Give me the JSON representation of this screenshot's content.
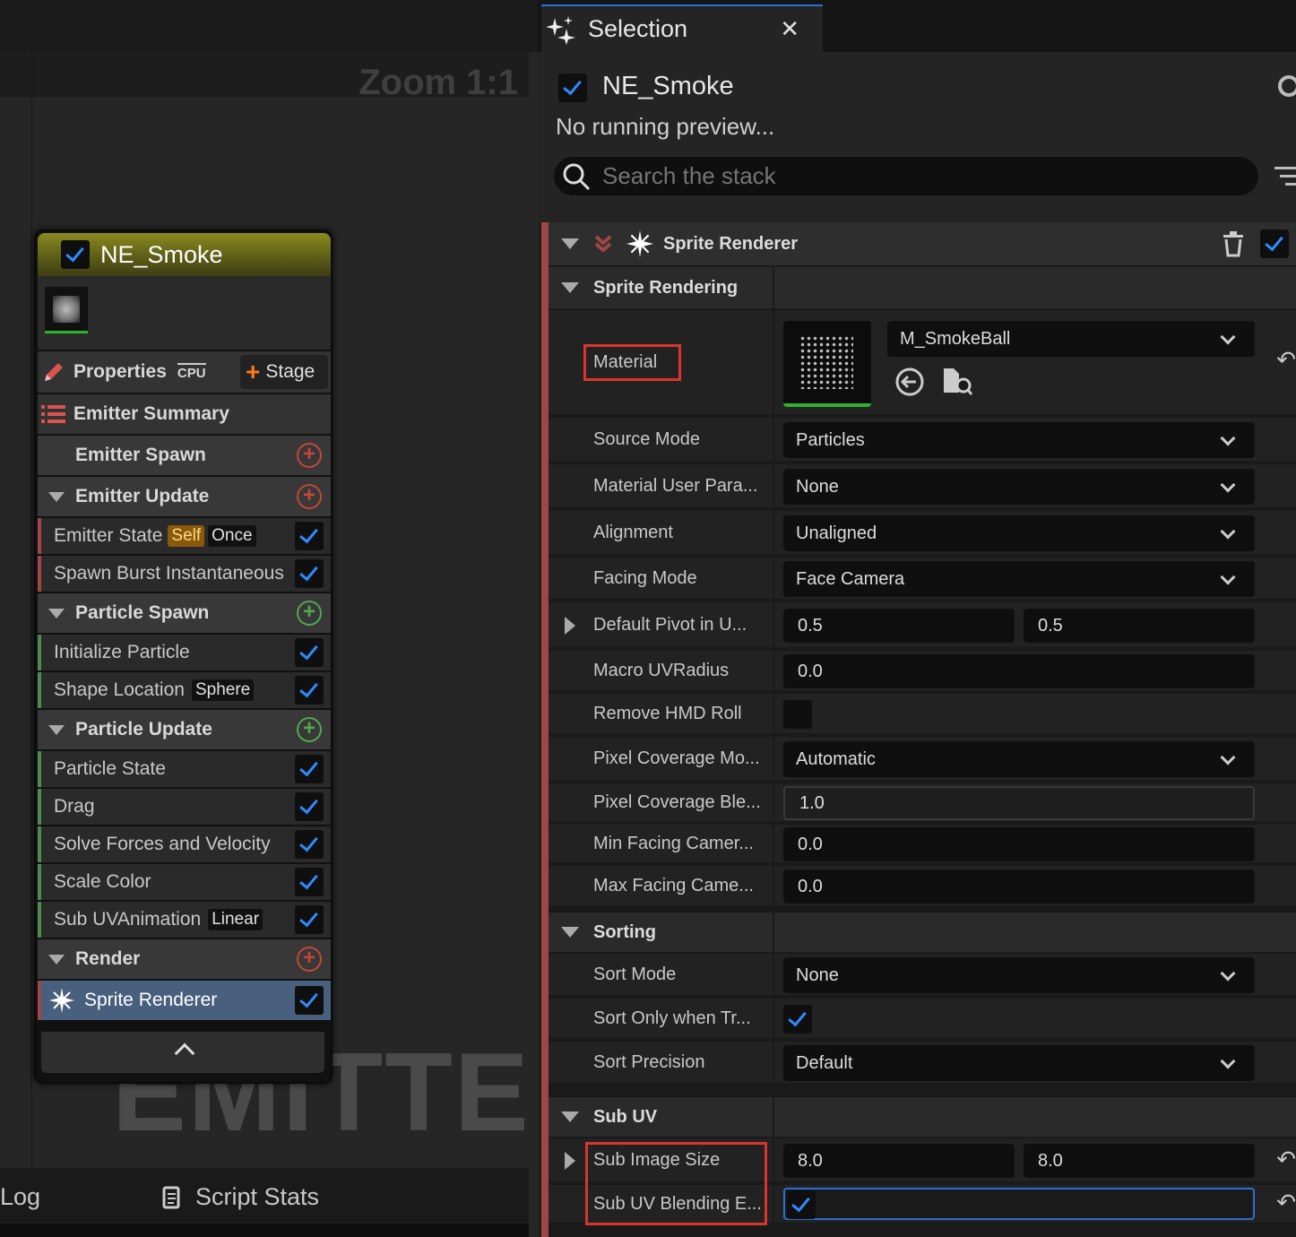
{
  "graph": {
    "zoom_label": "Zoom 1:1",
    "watermark": "EMITTER",
    "bottom_tabs": {
      "log": "Log",
      "script_stats": "Script Stats"
    }
  },
  "node": {
    "title": "NE_Smoke",
    "properties_label": "Properties",
    "cpu_label": "CPU",
    "stage_label": "Stage",
    "summary_label": "Emitter Summary",
    "emitter_spawn": "Emitter Spawn",
    "emitter_update": "Emitter Update",
    "emitter_state": {
      "label": "Emitter State",
      "tag1": "Self",
      "tag2": "Once"
    },
    "spawn_burst": "Spawn Burst Instantaneous",
    "particle_spawn": "Particle Spawn",
    "initialize_particle": "Initialize Particle",
    "shape_location": {
      "label": "Shape Location",
      "tag": "Sphere"
    },
    "particle_update": "Particle Update",
    "particle_state": "Particle State",
    "drag": "Drag",
    "solve_forces": "Solve Forces and Velocity",
    "scale_color": "Scale Color",
    "sub_uv_anim": {
      "label": "Sub UVAnimation",
      "tag": "Linear"
    },
    "render": "Render",
    "sprite_renderer": "Sprite Renderer"
  },
  "panel": {
    "tab_title": "Selection",
    "emitter_name": "NE_Smoke",
    "preview_status": "No running preview...",
    "search_placeholder": "Search the stack",
    "renderer_title": "Sprite Renderer",
    "sprite_rendering": "Sprite Rendering",
    "material": {
      "label": "Material",
      "value": "M_SmokeBall"
    },
    "source_mode": {
      "label": "Source Mode",
      "value": "Particles"
    },
    "material_user_param": {
      "label": "Material User Para...",
      "value": "None"
    },
    "alignment": {
      "label": "Alignment",
      "value": "Unaligned"
    },
    "facing_mode": {
      "label": "Facing Mode",
      "value": "Face Camera"
    },
    "default_pivot": {
      "label": "Default Pivot in U...",
      "x": "0.5",
      "y": "0.5"
    },
    "macro_uv_radius": {
      "label": "Macro UVRadius",
      "value": "0.0"
    },
    "remove_hmd_roll": {
      "label": "Remove HMD Roll"
    },
    "pixel_coverage_mode": {
      "label": "Pixel Coverage Mo...",
      "value": "Automatic"
    },
    "pixel_coverage_blend": {
      "label": "Pixel Coverage Ble...",
      "value": "1.0"
    },
    "min_facing": {
      "label": "Min Facing Camer...",
      "value": "0.0"
    },
    "max_facing": {
      "label": "Max Facing Came...",
      "value": "0.0"
    },
    "sorting": "Sorting",
    "sort_mode": {
      "label": "Sort Mode",
      "value": "None"
    },
    "sort_only": {
      "label": "Sort Only when Tr..."
    },
    "sort_precision": {
      "label": "Sort Precision",
      "value": "Default"
    },
    "sub_uv": "Sub UV",
    "sub_image_size": {
      "label": "Sub Image Size",
      "x": "8.0",
      "y": "8.0"
    },
    "sub_uv_blending": {
      "label": "Sub UV Blending E..."
    }
  },
  "colors": {
    "accent_blue": "#2d8cff",
    "highlight_red": "#d9352c",
    "node_header": "#8a8a1f",
    "renderer_bar": "#a04646"
  }
}
